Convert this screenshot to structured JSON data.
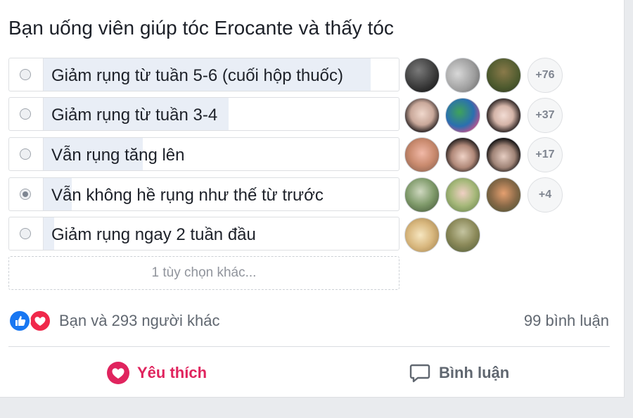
{
  "poll": {
    "question": "Bạn uống viên giúp tóc Erocante và thấy tóc",
    "options": [
      {
        "label": "Giảm rụng từ tuần 5-6 (cuối hộp thuốc)",
        "checked": false,
        "fill": 0.92,
        "more": "+76"
      },
      {
        "label": "Giảm rụng từ tuần 3-4",
        "checked": false,
        "fill": 0.52,
        "more": "+37"
      },
      {
        "label": "Vẫn rụng tăng lên",
        "checked": false,
        "fill": 0.28,
        "more": "+17"
      },
      {
        "label": "Vẫn không hề rụng như thế từ trước",
        "checked": true,
        "fill": 0.08,
        "more": "+4"
      },
      {
        "label": "Giảm rụng ngay 2 tuần đầu",
        "checked": false,
        "fill": 0.03,
        "more": ""
      }
    ],
    "add_option": "1 tùy chọn khác..."
  },
  "footer": {
    "reactions_text": "Bạn và 293 người khác",
    "comments_text": "99 bình luận",
    "like_label": "Yêu thích",
    "comment_label": "Bình luận"
  },
  "colors": {
    "like_icon": "#1877f2",
    "love_icon": "#f0284a",
    "love_action": "#e0245e",
    "comment_action": "#606770",
    "poll_fill": "#e9eef6"
  },
  "icons": [
    "like-reaction-icon",
    "love-reaction-icon",
    "heart-icon",
    "comment-icon"
  ]
}
